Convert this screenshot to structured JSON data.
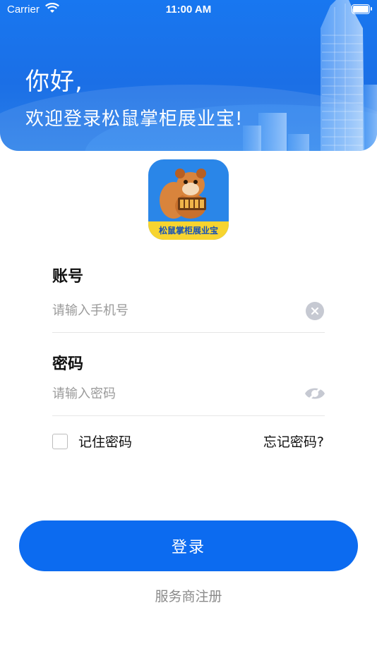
{
  "status_bar": {
    "carrier": "Carrier",
    "time": "11:00 AM"
  },
  "header": {
    "greeting": "你好,",
    "welcome": "欢迎登录松鼠掌柜展业宝!"
  },
  "logo": {
    "text": "松鼠掌柜展业宝"
  },
  "form": {
    "account_label": "账号",
    "account_placeholder": "请输入手机号",
    "password_label": "密码",
    "password_placeholder": "请输入密码",
    "remember_label": "记住密码",
    "forgot_label": "忘记密码?"
  },
  "login_label": "登录",
  "register_label": "服务商注册",
  "colors": {
    "primary": "#0c6bf0",
    "banner": "#1877f0",
    "logo_strip": "#f7d42f"
  }
}
